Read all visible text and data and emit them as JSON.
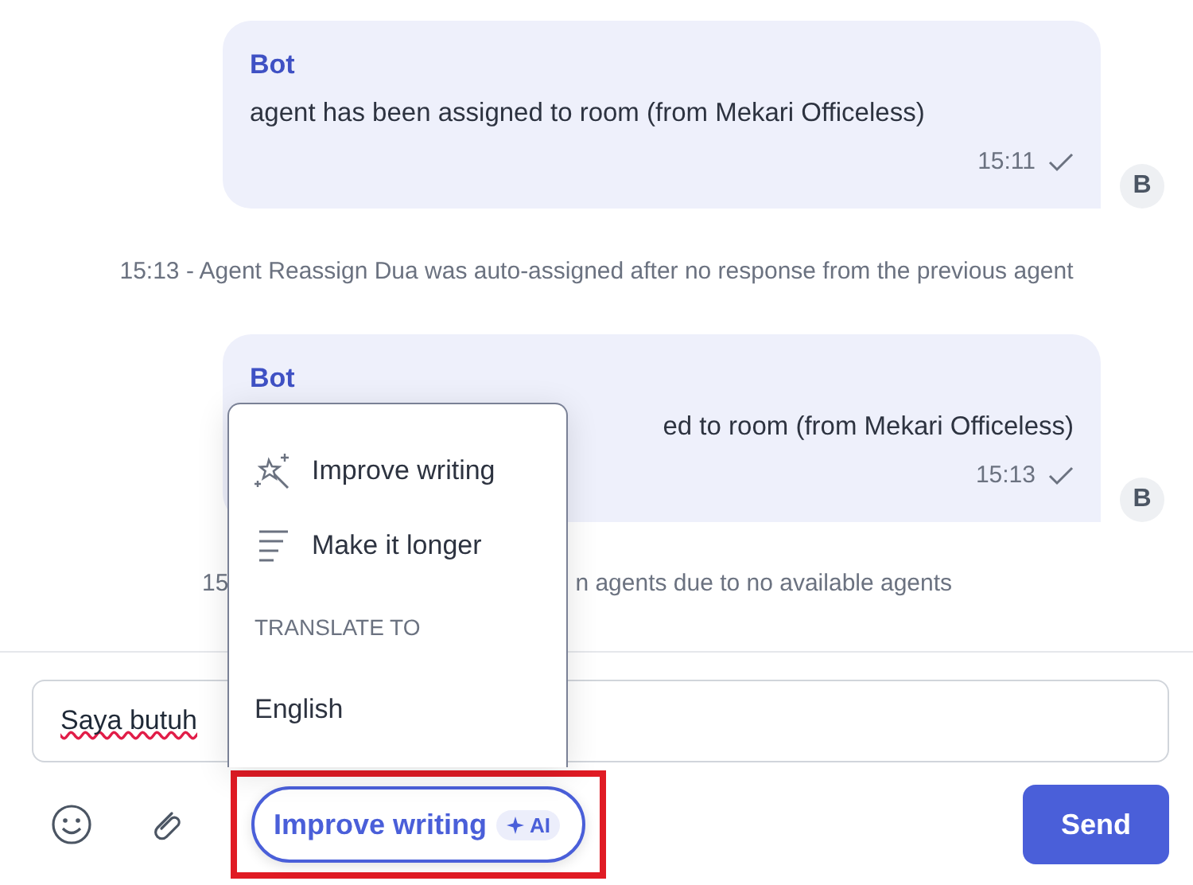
{
  "messages": [
    {
      "kind": "bubble",
      "sender": "Bot",
      "text": "agent has been assigned to room (from Mekari Officeless)",
      "time": "15:11",
      "read": true,
      "avatar": "B"
    },
    {
      "kind": "system",
      "parts": [
        "15:13 - Agent Reassign Dua was auto-assigned after no response from the previous agent"
      ]
    },
    {
      "kind": "bubble",
      "sender": "Bot",
      "text": "ed to room (from Mekari Officeless)",
      "time": "15:13",
      "read": true,
      "avatar": "B"
    },
    {
      "kind": "system",
      "parts": [
        "15",
        "n agents due to no available agents"
      ]
    }
  ],
  "menu": {
    "items": [
      {
        "kind": "improve",
        "label": "Improve writing"
      },
      {
        "kind": "lengthen",
        "label": "Make it longer"
      },
      {
        "kind": "header",
        "label": "TRANSLATE TO"
      },
      {
        "kind": "option",
        "label": "English"
      }
    ]
  },
  "composer": {
    "value": "Saya butuh",
    "ai_button": {
      "label": "Improve writing",
      "badge": "AI",
      "highlighted": true
    },
    "send": "Send"
  }
}
